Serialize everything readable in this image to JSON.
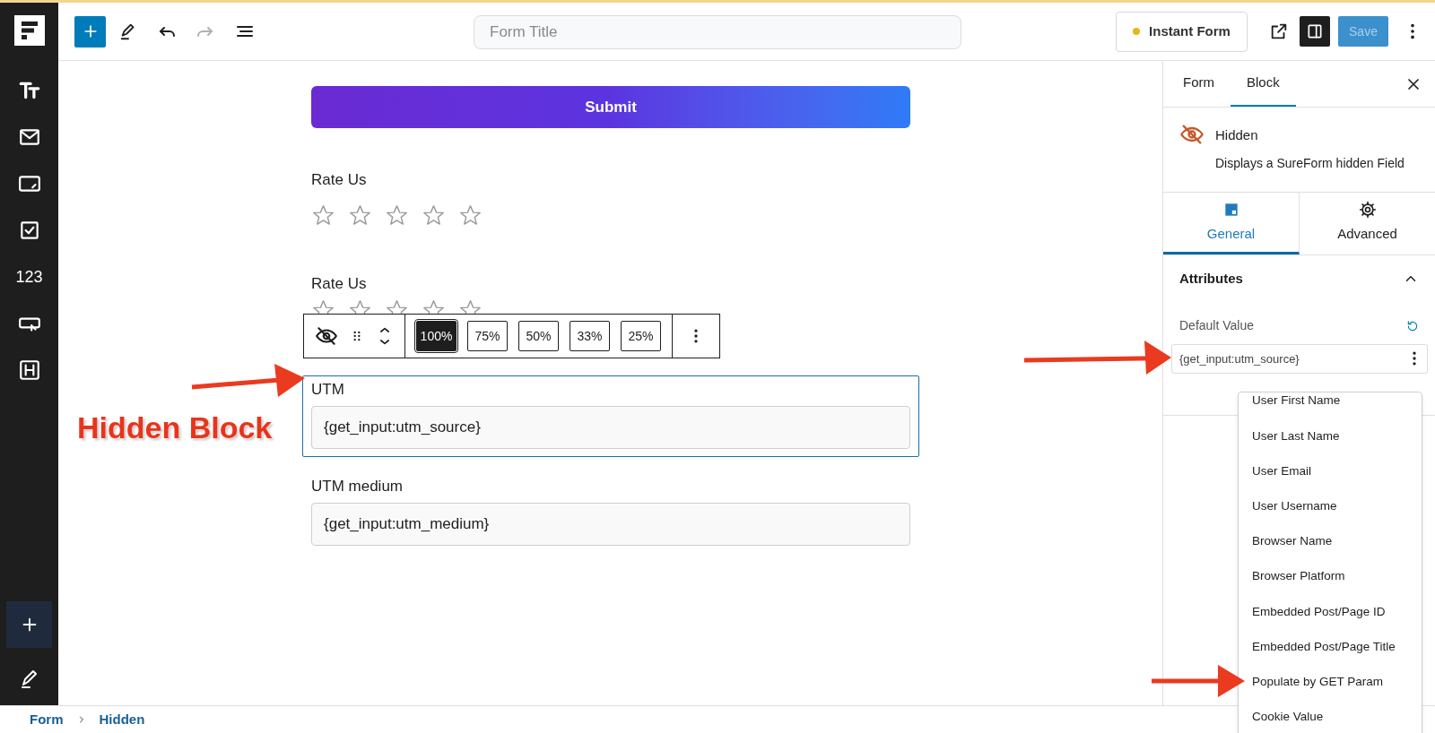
{
  "sidebar": {
    "number_item": "123"
  },
  "topbar": {
    "title_placeholder": "Form Title",
    "instant_form": "Instant Form",
    "redo": {
      "disabled": true
    },
    "settings_toggle": {
      "on": true
    },
    "save": {
      "label": "Save",
      "disabled": true
    }
  },
  "canvas": {
    "submit": "Submit",
    "fields": [
      {
        "kind": "rating",
        "label": "Rate Us",
        "stars": 0,
        "selected": false
      },
      {
        "kind": "rating",
        "label": "Rate Us",
        "selected": false
      },
      {
        "kind": "hidden",
        "label": "UTM",
        "value": "{get_input:utm_source}",
        "selected": true
      },
      {
        "kind": "hidden",
        "label": "UTM medium",
        "value": "{get_input:utm_medium}",
        "selected": false
      }
    ],
    "toolbar": {
      "widths": [
        {
          "label": "100%",
          "selected": true
        },
        {
          "label": "75%",
          "selected": false
        },
        {
          "label": "50%",
          "selected": false
        },
        {
          "label": "33%",
          "selected": false
        },
        {
          "label": "25%",
          "selected": false
        }
      ]
    }
  },
  "panel": {
    "tabs": [
      {
        "label": "Form",
        "selected": false
      },
      {
        "label": "Block",
        "selected": true
      }
    ],
    "block": {
      "title": "Hidden",
      "description": "Displays a SureForm hidden Field"
    },
    "subtabs": [
      {
        "label": "General",
        "selected": true
      },
      {
        "label": "Advanced",
        "selected": false
      }
    ],
    "section": {
      "title": "Attributes",
      "expanded": true
    },
    "default_value": {
      "label": "Default Value",
      "value": "{get_input:utm_source}"
    },
    "menu": [
      "User First Name",
      "User Last Name",
      "User Email",
      "User Username",
      "Browser Name",
      "Browser Platform",
      "Embedded Post/Page ID",
      "Embedded Post/Page Title",
      "Populate by GET Param",
      "Cookie Value"
    ]
  },
  "breadcrumb": [
    "Form",
    "Hidden"
  ],
  "annotation": "Hidden Block"
}
